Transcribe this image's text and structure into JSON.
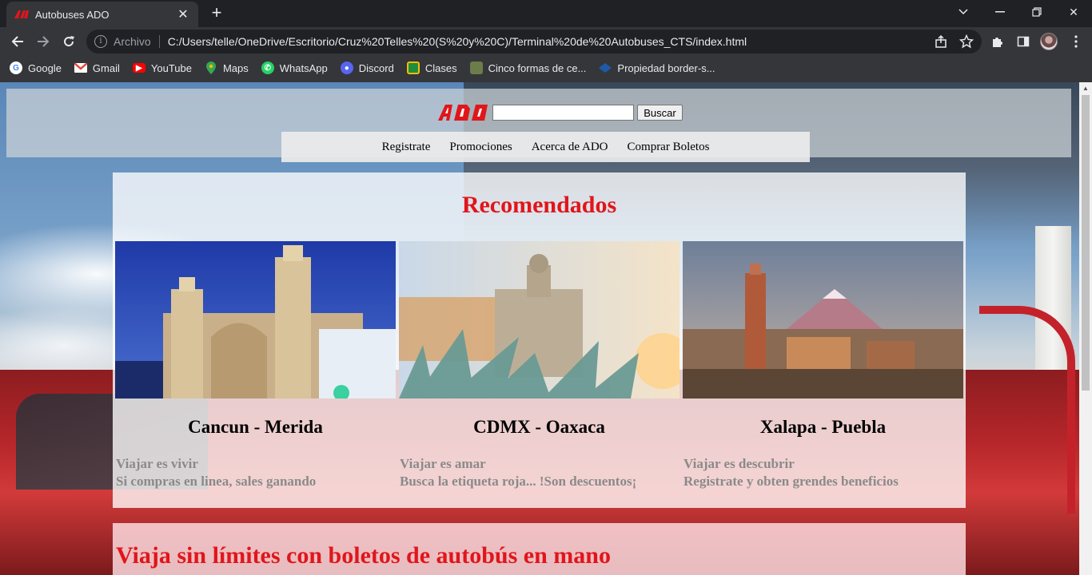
{
  "browser": {
    "tab_title": "Autobuses ADO",
    "new_tab": "+",
    "address_scheme": "Archivo",
    "address_url": "C:/Users/telle/OneDrive/Escritorio/Cruz%20Telles%20(S%20y%20C)/Terminal%20de%20Autobuses_CTS/index.html",
    "bookmarks": [
      {
        "label": "Google",
        "icon": "google-icon"
      },
      {
        "label": "Gmail",
        "icon": "gmail-icon"
      },
      {
        "label": "YouTube",
        "icon": "youtube-icon"
      },
      {
        "label": "Maps",
        "icon": "maps-icon"
      },
      {
        "label": "WhatsApp",
        "icon": "whatsapp-icon"
      },
      {
        "label": "Discord",
        "icon": "discord-icon"
      },
      {
        "label": "Clases",
        "icon": "classroom-icon"
      },
      {
        "label": "Cinco formas de ce...",
        "icon": "site-icon"
      },
      {
        "label": "Propiedad border-s...",
        "icon": "site-icon"
      }
    ]
  },
  "header": {
    "logo_text": "ADO",
    "search_value": "",
    "search_button": "Buscar",
    "nav": [
      "Registrate",
      "Promociones",
      "Acerca de ADO",
      "Comprar Boletos"
    ]
  },
  "recomendados": {
    "title": "Recomendados",
    "cards": [
      {
        "title": "Cancun - Merida",
        "line1": "Viajar es vivir",
        "line2": "Si compras en linea, sales ganando"
      },
      {
        "title": "CDMX - Oaxaca",
        "line1": "Viajar es amar",
        "line2": "Busca la etiqueta roja... !Son descuentos¡"
      },
      {
        "title": "Xalapa - Puebla",
        "line1": "Viajar es descubrir",
        "line2": "Registrate y obten grendes beneficios"
      }
    ]
  },
  "banner": {
    "text": "Viaja sin límites con boletos de autobús en mano"
  },
  "colors": {
    "brand_red": "#e0161b",
    "chrome_dark": "#202124",
    "chrome_toolbar": "#35363a"
  }
}
